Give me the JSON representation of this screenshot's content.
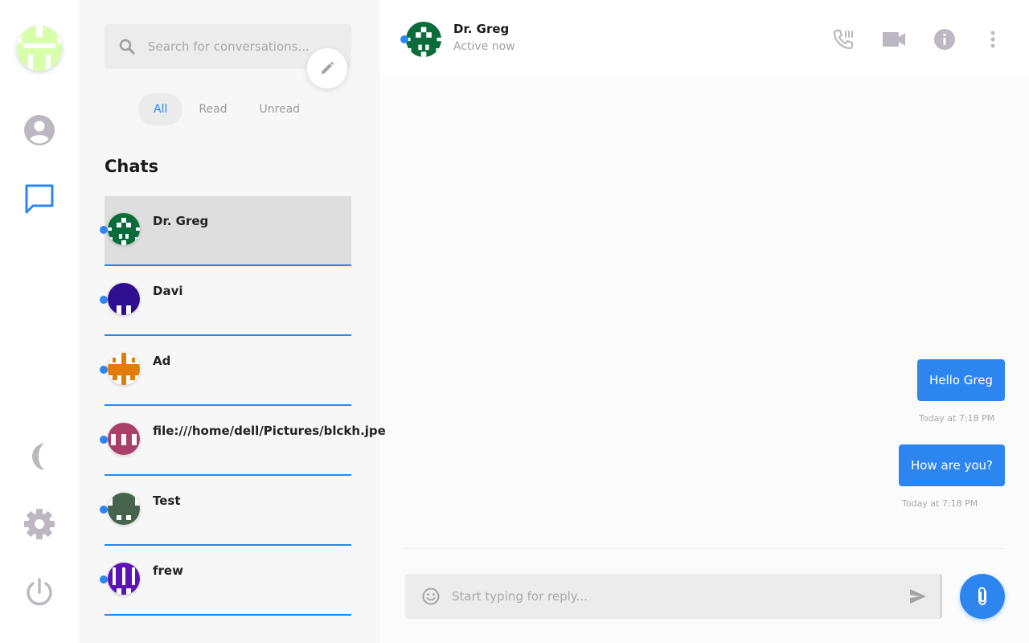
{
  "app": {
    "accent_color": "#2d86f0",
    "selected_row_color": "#dedede"
  },
  "rail": {
    "user_avatar_color": "#d8ffaa",
    "items": [
      {
        "icon": "user-icon"
      },
      {
        "icon": "chat-bubble-icon",
        "active": true
      },
      {
        "icon": "moon-icon"
      },
      {
        "icon": "gear-icon"
      },
      {
        "icon": "power-icon"
      }
    ]
  },
  "sidebar": {
    "search_placeholder": "Search for conversations...",
    "compose_icon": "pencil-icon",
    "filters": [
      {
        "label": "All",
        "active": true
      },
      {
        "label": "Read"
      },
      {
        "label": "Unread"
      }
    ],
    "chats_title": "Chats",
    "chats": [
      {
        "name": "Dr. Greg",
        "avatar_color": "#0b6b3a",
        "online": true,
        "selected": true
      },
      {
        "name": "Davi",
        "avatar_color": "#2e0f8f",
        "online": true
      },
      {
        "name": "Ad",
        "avatar_color": "#e07c0a",
        "online": true
      },
      {
        "name": "file:///home/dell/Pictures/blckh.jpe",
        "avatar_color": "#a8406a",
        "online": true
      },
      {
        "name": "Test",
        "avatar_color": "#46634e",
        "online": true
      },
      {
        "name": "frew",
        "avatar_color": "#5d12b8",
        "online": true
      }
    ]
  },
  "conversation": {
    "contact_name": "Dr. Greg",
    "contact_status": "Active now",
    "contact_avatar_color": "#0b6b3a",
    "header_actions": [
      "phone-icon",
      "video-camera-icon",
      "info-icon",
      "more-vertical-icon"
    ],
    "messages": [
      {
        "text": "Hello Greg",
        "time": "Today at 7:18 PM",
        "outgoing": true
      },
      {
        "text": "How are you?",
        "time": "Today at 7:18 PM",
        "outgoing": true
      }
    ],
    "composer_placeholder": "Start typing for reply...",
    "emoji_icon": "smiley-icon",
    "send_icon": "send-icon",
    "attach_icon": "paperclip-icon"
  }
}
